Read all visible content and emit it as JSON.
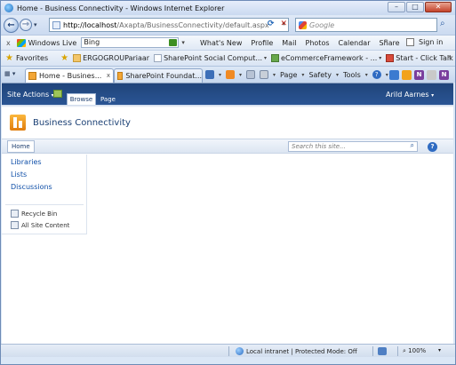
{
  "window": {
    "title": "Home - Business Connectivity - Windows Internet Explorer",
    "minimize": "–",
    "maximize": "□",
    "close": "✕"
  },
  "addressbar": {
    "url_host": "http://localhost",
    "url_path": "/Axapta/BusinessConnectivity/default.aspx",
    "search_placeholder": "Google"
  },
  "livebar": {
    "close": "x",
    "brand": "Windows Live",
    "search_value": "Bing",
    "links": [
      "What's New",
      "Profile",
      "Mail",
      "Photos",
      "Calendar",
      "Share"
    ],
    "more": "»",
    "sign_in": "Sign in"
  },
  "favbar": {
    "favorites": "Favorites",
    "items": [
      "ERGOGROUPariaar",
      "SharePoint Social Comput...",
      "eCommerceFramework - ...",
      "Start - Click Talk"
    ],
    "more": "»"
  },
  "tabbar": {
    "tabs": [
      "Home - Busines...",
      "SharePoint Foundat..."
    ],
    "close": "x",
    "commands": {
      "page": "Page",
      "safety": "Safety",
      "tools": "Tools"
    },
    "help": "?"
  },
  "sharepoint": {
    "site_actions": "Site Actions",
    "ribbon_tabs": [
      "Browse",
      "Page"
    ],
    "user": "Arild Aarnes",
    "site_title": "Business Connectivity",
    "topnav_home": "Home",
    "search_placeholder": "Search this site...",
    "help": "?",
    "quicklaunch": [
      "Libraries",
      "Lists",
      "Discussions"
    ],
    "recycle_bin": "Recycle Bin",
    "all_site_content": "All Site Content"
  },
  "statusbar": {
    "zone": "Local intranet | Protected Mode: Off",
    "zoom": "100%"
  }
}
